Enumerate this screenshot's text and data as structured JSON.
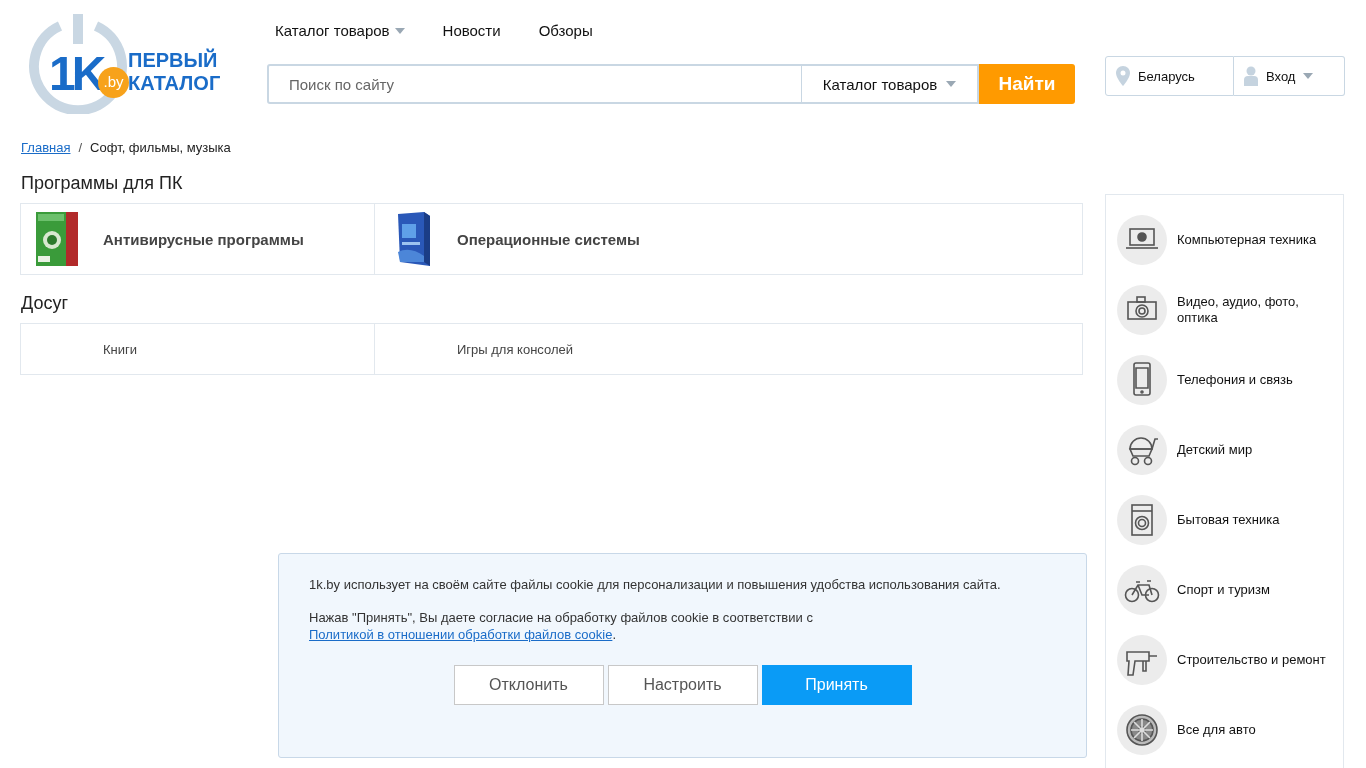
{
  "logo": {
    "mark": "1K",
    "domain": ".by",
    "line_1": "ПЕРВЫЙ",
    "line_2": "КАТАЛОГ"
  },
  "nav": [
    {
      "label": "Каталог товаров",
      "dropdown": true
    },
    {
      "label": "Новости",
      "dropdown": false
    },
    {
      "label": "Обзоры",
      "dropdown": false
    }
  ],
  "search": {
    "placeholder": "Поиск по сайту",
    "scope": "Каталог товаров",
    "button": "Найти"
  },
  "region": "Беларусь",
  "login": "Вход",
  "breadcrumb": {
    "home": "Главная",
    "separator": "/",
    "current": "Софт, фильмы, музыка"
  },
  "sections": [
    {
      "title": "Программы для ПК",
      "items": [
        {
          "label": "Антивирусные программы",
          "kind": "picture"
        },
        {
          "label": "Операционные системы",
          "kind": "picture"
        }
      ]
    },
    {
      "title": "Досуг",
      "items": [
        {
          "label": "Книги",
          "kind": "plain"
        },
        {
          "label": "Игры для консолей",
          "kind": "plain"
        }
      ]
    }
  ],
  "categories": [
    "Компьютерная техника",
    "Видео, аудио, фото, оптика",
    "Телефония и связь",
    "Детский мир",
    "Бытовая техника",
    "Спорт и туризм",
    "Строительство и ремонт",
    "Все для авто"
  ],
  "cookie": {
    "text": "1k.by использует на своём сайте файлы cookie для персонализации и повышения удобства использования сайта.",
    "consent": "Нажав \"Принять\", Вы даете согласие на обработку файлов cookie в соответствии с",
    "link": "Политикой в отношении обработки файлов cookie",
    "end": ".",
    "buttons": [
      {
        "label": "Отклонить",
        "kind": "secondary"
      },
      {
        "label": "Настроить",
        "kind": "secondary"
      },
      {
        "label": "Принять",
        "kind": "primary"
      }
    ]
  }
}
